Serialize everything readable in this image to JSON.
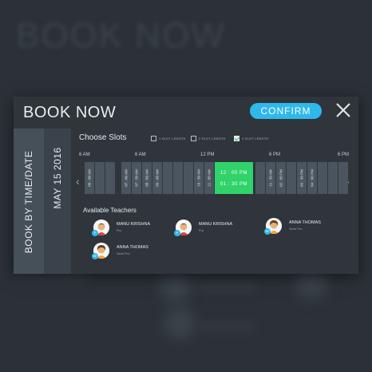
{
  "background": {
    "title": "BOOK NOW"
  },
  "modal": {
    "title": "BOOK NOW",
    "confirm_label": "CONFIRM",
    "close_icon": "close-icon",
    "side_label_primary": "BOOK BY TIME/DATE",
    "side_label_secondary": "MAY 15 2016"
  },
  "choose_slots": {
    "title": "Choose Slots",
    "options": [
      {
        "label": "1 SLOT LENGTH",
        "checked": false
      },
      {
        "label": "2 SLOT LENGTH",
        "checked": false
      },
      {
        "label": "4 SLOT LENGTH",
        "checked": true
      }
    ]
  },
  "timeline": {
    "labels": [
      "6 AM",
      "6 AM",
      "12 PM",
      "6 PM",
      "6 PM"
    ]
  },
  "slots": [
    {
      "label": "06 : 00 AM"
    },
    {
      "label": "07 : 00 AM"
    },
    {
      "label": "07 : 30 AM"
    },
    {
      "label": "08 : 00 AM"
    },
    {
      "label": "09 : 00 AM"
    },
    {
      "label": "10 : 30 AM"
    },
    {
      "label": "11 : 00 AM"
    },
    {
      "label": "11 : 30 AM"
    },
    {
      "label": "02 : 00 PM"
    },
    {
      "label": "03 : 30 PM"
    },
    {
      "label": "04 : 00 PM"
    }
  ],
  "selected_slot": {
    "start": "12 : 00 PM",
    "end": "01 : 30 PM"
  },
  "teachers": {
    "title": "Available Teachers",
    "items": [
      {
        "name": "MANU KRISHNA",
        "level": "Pro",
        "badge": "P"
      },
      {
        "name": "MANU KRISHNA",
        "level": "Pro",
        "badge": "P"
      },
      {
        "name": "ANNA THOMAS",
        "level": "Semi Pro",
        "badge": "SP"
      },
      {
        "name": "ANNA THOMAS",
        "level": "Semi Pro",
        "badge": "SP"
      }
    ]
  },
  "colors": {
    "accent_blue": "#2fb8ea",
    "selected_green": "#2fd36a",
    "panel_bg": "#2f353b"
  }
}
